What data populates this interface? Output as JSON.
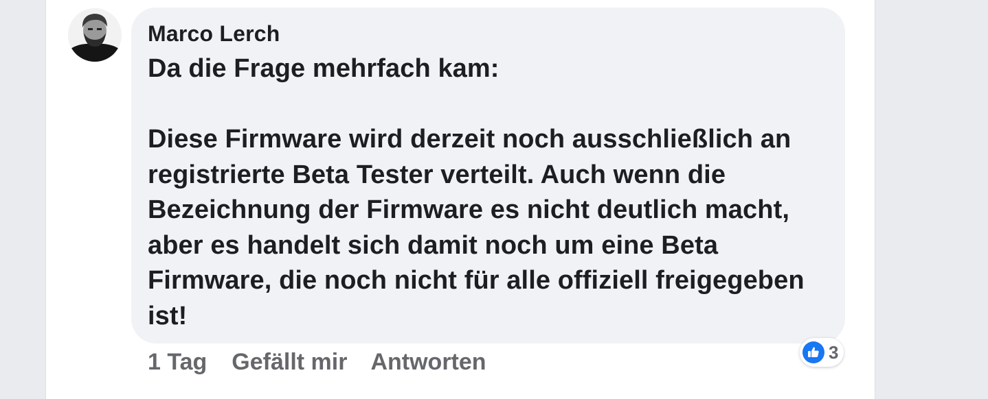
{
  "comment": {
    "author": "Marco Lerch",
    "text": "Da die Frage mehrfach kam:\n\nDiese Firmware wird derzeit noch ausschließlich an registrierte Beta Tester verteilt. Auch wenn die Bezeichnung der Firmware es nicht deutlich macht, aber es handelt sich damit noch um eine Beta Firmware, die noch nicht für alle offiziell freigegeben ist!",
    "timestamp": "1 Tag",
    "like_label": "Gefällt mir",
    "reply_label": "Antworten",
    "reactions": {
      "icon": "thumbs-up-icon",
      "count": "3",
      "color": "#1877f2"
    }
  },
  "colors": {
    "bubble": "#f0f2f5",
    "text": "#1c1e21",
    "secondary_text": "#65676b",
    "page_background": "#e9ebee"
  }
}
